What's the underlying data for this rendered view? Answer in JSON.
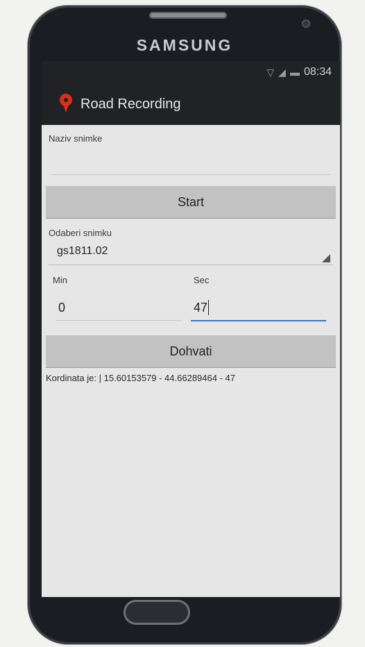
{
  "device": {
    "brand": "SAMSUNG"
  },
  "statusbar": {
    "time": "08:34",
    "wifi_icon": "wifi-icon",
    "battery_icon": "battery-icon"
  },
  "actionbar": {
    "title": "Road Recording",
    "icon": "map-pin-icon",
    "icon_color": "#d9301c"
  },
  "form": {
    "recording_name_label": "Naziv snimke",
    "recording_name_value": "",
    "start_button": "Start",
    "select_recording_label": "Odaberi snimku",
    "select_recording_value": "gs1811.02",
    "min_label": "Min",
    "sec_label": "Sec",
    "min_value": "0",
    "sec_value": "47",
    "fetch_button": "Dohvati",
    "result_text": "Kordinata je:  | 15.60153579 - 44.66289464 - 47"
  },
  "colors": {
    "focus_accent": "#3b72c6",
    "button_bg": "#c2c2c2",
    "screen_bg": "#e6e6e6"
  }
}
